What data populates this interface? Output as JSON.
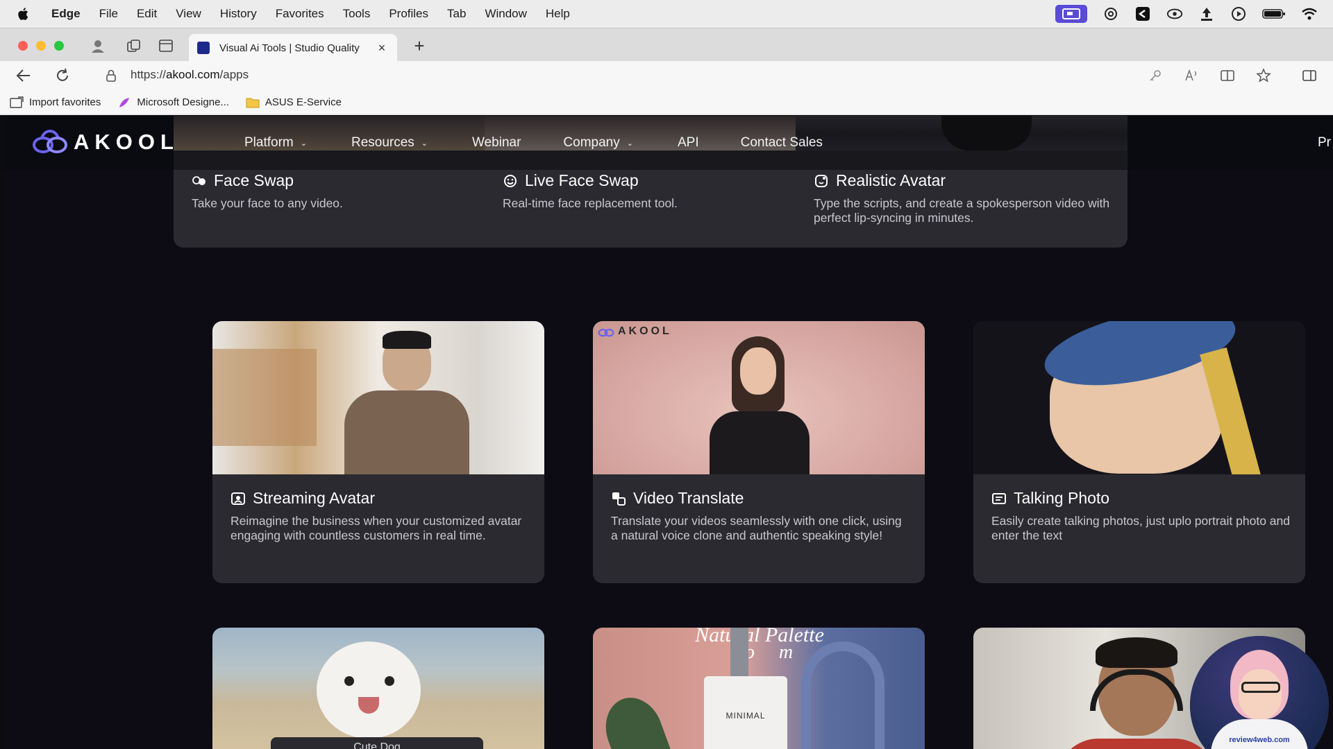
{
  "menubar": {
    "app": "Edge",
    "items": [
      "File",
      "Edit",
      "View",
      "History",
      "Favorites",
      "Tools",
      "Profiles",
      "Tab",
      "Window",
      "Help"
    ]
  },
  "tab": {
    "title": "Visual Ai Tools | Studio Quality",
    "close": "×",
    "new_tab": "+"
  },
  "address": {
    "scheme": "https://",
    "host": "akool.com",
    "path": "/apps"
  },
  "bookmarks": [
    {
      "label": "Import favorites",
      "icon": "import-icon"
    },
    {
      "label": "Microsoft Designe...",
      "icon": "designer-icon"
    },
    {
      "label": "ASUS E-Service",
      "icon": "folder-icon"
    }
  ],
  "site": {
    "logo_text": "AKOOL",
    "nav": [
      {
        "label": "Platform",
        "dropdown": true
      },
      {
        "label": "Resources",
        "dropdown": true
      },
      {
        "label": "Webinar",
        "dropdown": false
      },
      {
        "label": "Company",
        "dropdown": true
      },
      {
        "label": "API",
        "dropdown": false
      },
      {
        "label": "Contact Sales",
        "dropdown": false
      }
    ],
    "nav_cut": "Pr"
  },
  "cards": {
    "face_swap": {
      "title": "Face Swap",
      "desc": "Take your face to any video."
    },
    "live_face_swap": {
      "title": "Live Face Swap",
      "desc": "Real-time face replacement tool."
    },
    "realistic_avatar": {
      "title": "Realistic Avatar",
      "desc": "Type the scripts, and create a spokesperson video with perfect lip-syncing in minutes."
    },
    "streaming_avatar": {
      "title": "Streaming Avatar",
      "desc": "Reimagine the business when your customized avatar engaging with countless customers in real time."
    },
    "video_translate": {
      "title": "Video Translate",
      "desc": "Translate your videos seamlessly with one click,  using a natural voice clone and authentic speaking style!",
      "thumb_logo": "AKOOL"
    },
    "talking_photo": {
      "title": "Talking Photo",
      "desc": "Easily create talking photos, just uplo portrait photo and enter the text"
    },
    "row3_center": {
      "caption": "Natural Palette",
      "sub": "Po     m",
      "bottle": "MINIMAL"
    },
    "row3_left": {
      "caption": "Cute Dog"
    }
  },
  "webcam": {
    "shirt": "review4web.com"
  },
  "colors": {
    "card_bg": "#2b2a30",
    "page_bg": "#0d0c14",
    "brand": "#6a63f0"
  }
}
